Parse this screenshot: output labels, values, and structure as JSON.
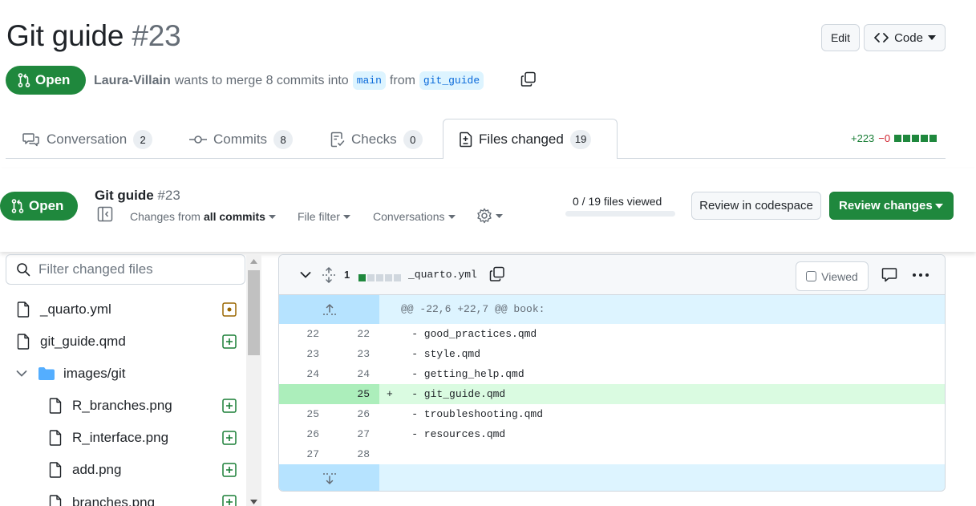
{
  "pr": {
    "title": "Git guide",
    "number": "#23",
    "state": "Open",
    "author": "Laura-Villain",
    "merge_text": "wants to merge 8 commits into",
    "base_branch": "main",
    "from_text": "from",
    "head_branch": "git_guide"
  },
  "header_actions": {
    "edit": "Edit",
    "code": "Code"
  },
  "tabs": [
    {
      "label": "Conversation",
      "count": "2"
    },
    {
      "label": "Commits",
      "count": "8"
    },
    {
      "label": "Checks",
      "count": "0"
    },
    {
      "label": "Files changed",
      "count": "19"
    }
  ],
  "diffstat": {
    "additions": "+223",
    "deletions": "−0",
    "colors": {
      "add": "#1f883d"
    }
  },
  "toolbar": {
    "changes_from_prefix": "Changes from",
    "changes_from_value": "all commits",
    "file_filter": "File filter",
    "conversations": "Conversations",
    "files_viewed": "0 / 19 files viewed",
    "files_viewed_progress": 0,
    "review_in_codespace": "Review in codespace",
    "review_changes": "Review changes"
  },
  "file_tree": {
    "filter_placeholder": "Filter changed files",
    "items": [
      {
        "name": "_quarto.yml",
        "type": "file",
        "status": "modified"
      },
      {
        "name": "git_guide.qmd",
        "type": "file",
        "status": "added"
      },
      {
        "name": "images/git",
        "type": "folder",
        "expanded": true
      },
      {
        "name": "R_branches.png",
        "type": "file",
        "status": "added"
      },
      {
        "name": "R_interface.png",
        "type": "file",
        "status": "added"
      },
      {
        "name": "add.png",
        "type": "file",
        "status": "added"
      },
      {
        "name": "branches.png",
        "type": "file",
        "status": "added"
      }
    ]
  },
  "diff": {
    "file_name": "_quarto.yml",
    "changes_count": "1",
    "viewed_label": "Viewed",
    "hunk_header": "@@ -22,6 +22,7 @@ book:",
    "lines": [
      {
        "old": "22",
        "new": "22",
        "sign": "",
        "code": "    - good_practices.qmd",
        "type": "context"
      },
      {
        "old": "23",
        "new": "23",
        "sign": "",
        "code": "    - style.qmd",
        "type": "context"
      },
      {
        "old": "24",
        "new": "24",
        "sign": "",
        "code": "    - getting_help.qmd",
        "type": "context"
      },
      {
        "old": "",
        "new": "25",
        "sign": "+",
        "code": "    - git_guide.qmd",
        "type": "added"
      },
      {
        "old": "25",
        "new": "26",
        "sign": "",
        "code": "    - troubleshooting.qmd",
        "type": "context"
      },
      {
        "old": "26",
        "new": "27",
        "sign": "",
        "code": "    - resources.qmd",
        "type": "context"
      },
      {
        "old": "27",
        "new": "28",
        "sign": "",
        "code": "",
        "type": "context"
      }
    ]
  }
}
